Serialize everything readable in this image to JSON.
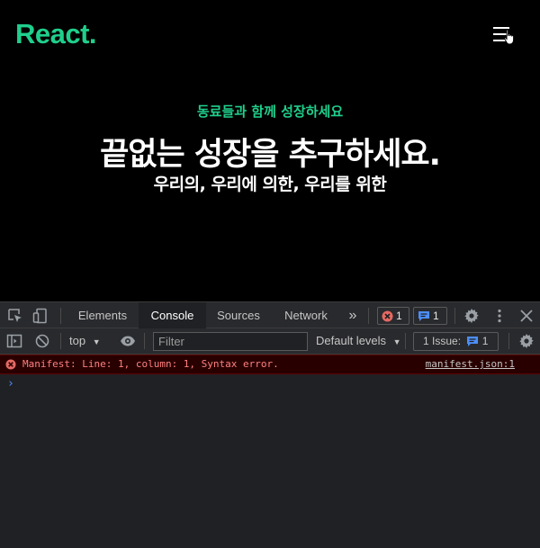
{
  "site": {
    "logo": "React.",
    "menu_icon": "hamburger-menu-icon",
    "eyebrow": "동료들과 함께 성장하세요",
    "title": "끝없는 성장을 추구하세요.",
    "subtitle": "우리의, 우리에 의한, 우리를 위한",
    "accent_color": "#1fcf8c"
  },
  "devtools": {
    "tabs": [
      "Elements",
      "Console",
      "Sources",
      "Network"
    ],
    "active_tab": "Console",
    "more_tabs": "»",
    "error_count": "1",
    "message_count": "1",
    "context": "top",
    "filter_placeholder": "Filter",
    "levels_label": "Default levels",
    "issue_label": "1 Issue:",
    "issue_count": "1",
    "console": {
      "error_message": "Manifest: Line: 1, column: 1, Syntax error.",
      "error_source": "manifest.json:1",
      "prompt": "›"
    }
  }
}
